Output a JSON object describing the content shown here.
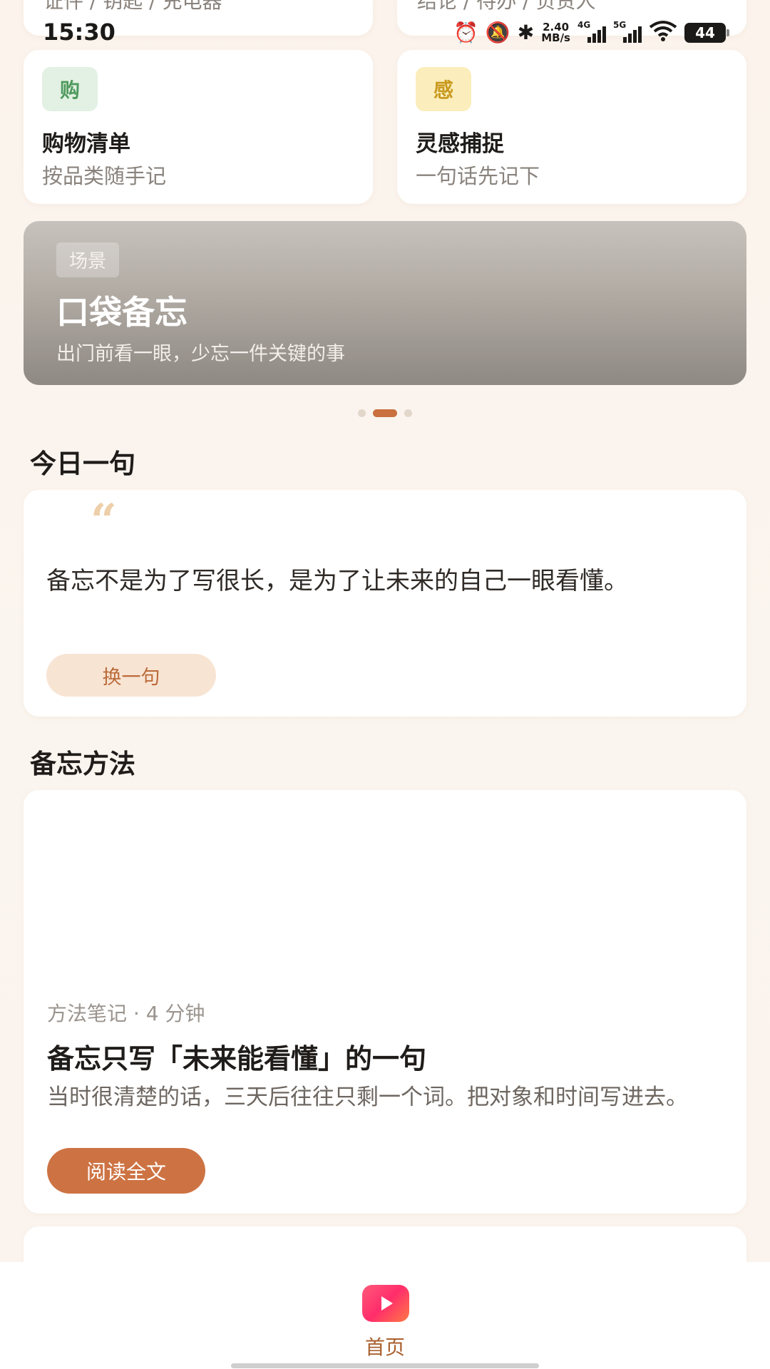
{
  "status_bar": {
    "time": "15:30",
    "net_speed_value": "2.40",
    "net_speed_unit": "MB/s",
    "signal1_label": "4G",
    "signal2_label": "5G",
    "battery": "44"
  },
  "top_cards": {
    "left_text": "证件 / 钥匙 / 充电器",
    "right_text": "结论 / 待办 / 负责人"
  },
  "tiles": [
    {
      "badge": "购",
      "title": "购物清单",
      "subtitle": "按品类随手记",
      "badge_bg": "#e2f1e3",
      "badge_color": "#4f9a5d"
    },
    {
      "badge": "感",
      "title": "灵感捕捉",
      "subtitle": "一句话先记下",
      "badge_bg": "#fbeebc",
      "badge_color": "#c99a1e"
    }
  ],
  "banner": {
    "tag": "场景",
    "title": "口袋备忘",
    "subtitle": "出门前看一眼，少忘一件关键的事",
    "active_page": 2,
    "page_count": 3
  },
  "daily": {
    "section_title": "今日一句",
    "quote": "备忘不是为了写很长，是为了让未来的自己一眼看懂。",
    "button": "换一句"
  },
  "methods": {
    "section_title": "备忘方法",
    "meta": "方法笔记 · 4 分钟",
    "title": "备忘只写「未来能看懂」的一句",
    "description": "当时很清楚的话，三天后往往只剩一个词。把对象和时间写进去。",
    "button": "阅读全文"
  },
  "bottom_nav": {
    "items": [
      {
        "label": "首页",
        "icon": "play-icon",
        "active": true
      }
    ]
  },
  "colors": {
    "accent": "#cd7343",
    "background": "#fbf4ee"
  }
}
